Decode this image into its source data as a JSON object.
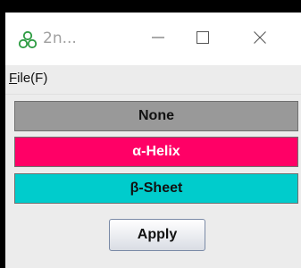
{
  "window": {
    "title": "2n...",
    "app_icon": "molecule-icon"
  },
  "titlebar_controls": {
    "minimize_icon": "minimize-icon",
    "maximize_icon": "maximize-icon",
    "close_icon": "close-icon"
  },
  "menubar": {
    "items": [
      {
        "label": "File(F)",
        "mnemonic": "F",
        "rest": "ile(F)"
      }
    ]
  },
  "secondary_structure": {
    "options": [
      {
        "label": "None",
        "color": "#999999",
        "text_color": "#111111"
      },
      {
        "label": "α-Helix",
        "color": "#ff0066",
        "text_color": "#ffffff"
      },
      {
        "label": "β-Sheet",
        "color": "#00cccc",
        "text_color": "#111111"
      }
    ]
  },
  "actions": {
    "apply_label": "Apply"
  }
}
